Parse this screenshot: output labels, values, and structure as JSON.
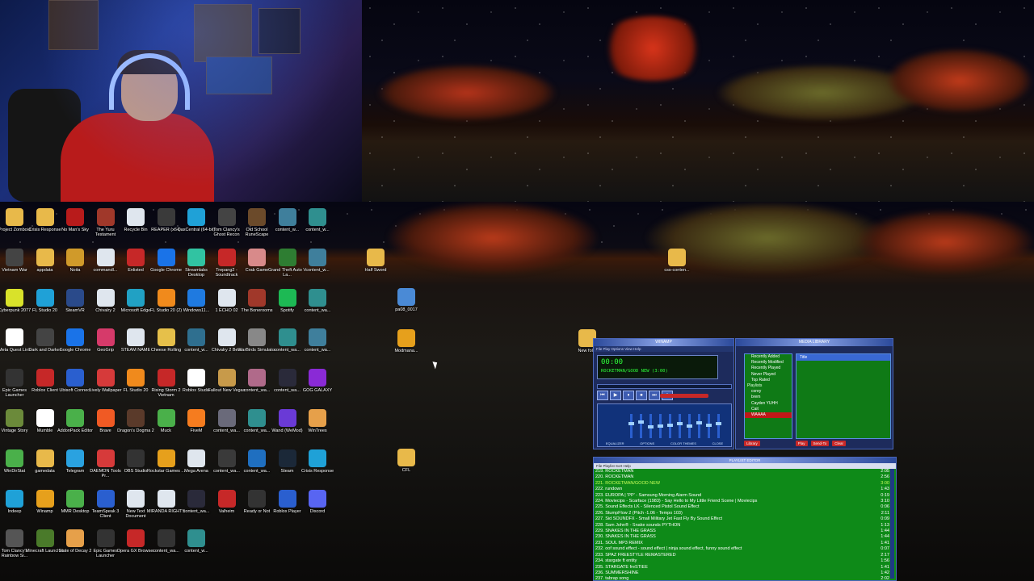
{
  "desktop_icons": [
    {
      "label": "Project Zomboid",
      "icon": "folder-icon",
      "color": "#e8b94a"
    },
    {
      "label": "Crisis Response",
      "icon": "folder-icon",
      "color": "#e8b94a"
    },
    {
      "label": "No Man's Sky",
      "icon": "game-icon",
      "color": "#b81b1b"
    },
    {
      "label": "The Yuru Testament",
      "icon": "game-icon",
      "color": "#a0382a"
    },
    {
      "label": "Recycle Bin",
      "icon": "recycle-bin-icon",
      "color": "#dfe6ee"
    },
    {
      "label": "REAPER (x64)",
      "icon": "reaper-icon",
      "color": "#3a3a3a"
    },
    {
      "label": "DaxCentral (64-bit)",
      "icon": "pc-icon",
      "color": "#1fa1d7"
    },
    {
      "label": "Tom Clancy's Ghost Recon",
      "icon": "game-icon",
      "color": "#444"
    },
    {
      "label": "Old School RuneScape",
      "icon": "game-icon",
      "color": "#6b4a2a"
    },
    {
      "label": "content_w...",
      "icon": "image-icon",
      "color": "#3f7f9c"
    },
    {
      "label": "content_w...",
      "icon": "image-icon",
      "color": "#2f8f8f"
    },
    {
      "label": "Vietnam War",
      "icon": "v-icon",
      "color": "#444"
    },
    {
      "label": "appdata",
      "icon": "folder-icon",
      "color": "#e8b94a"
    },
    {
      "label": "Noita",
      "icon": "game-icon",
      "color": "#d09a2a"
    },
    {
      "label": "commandl...",
      "icon": "doc-icon",
      "color": "#dfe6ee"
    },
    {
      "label": "Enlisted",
      "icon": "game-icon",
      "color": "#c62828"
    },
    {
      "label": "Google Chrome",
      "icon": "g-icon",
      "color": "#1a73e8"
    },
    {
      "label": "Streamlabs Desktop",
      "icon": "streamlabs-icon",
      "color": "#31c3a2"
    },
    {
      "label": "Trepang2 - Soundtrack",
      "icon": "game-icon",
      "color": "#c62828"
    },
    {
      "label": "Crab Game",
      "icon": "game-icon",
      "color": "#d88a8a"
    },
    {
      "label": "Grand Theft Auto V La...",
      "icon": "v-icon",
      "color": "#2e7d32"
    },
    {
      "label": "content_w...",
      "icon": "image-icon",
      "color": "#3f7f9c"
    },
    {
      "label": "Cyberpunk 2077",
      "icon": "game-icon",
      "color": "#d9e22a"
    },
    {
      "label": "FL Studio 20",
      "icon": "flstudio-icon",
      "color": "#1fa1d7"
    },
    {
      "label": "SteamVR",
      "icon": "vr-icon",
      "color": "#2a4a8a"
    },
    {
      "label": "Chivalry 2",
      "icon": "doc-icon",
      "color": "#dfe6ee"
    },
    {
      "label": "Microsoft Edge",
      "icon": "edge-icon",
      "color": "#21a1c4"
    },
    {
      "label": "FL Studio 20 (2)",
      "icon": "flstudio-icon",
      "color": "#f08a1c"
    },
    {
      "label": "Windows11...",
      "icon": "windows-icon",
      "color": "#1f7ae0"
    },
    {
      "label": "1 ECHO 02",
      "icon": "doc-icon",
      "color": "#dfe6ee"
    },
    {
      "label": "The Bonerooms",
      "icon": "game-icon",
      "color": "#a0382a"
    },
    {
      "label": "Spotify",
      "icon": "spotify-icon",
      "color": "#1db954"
    },
    {
      "label": "content_wa...",
      "icon": "image-icon",
      "color": "#2f8f8f"
    },
    {
      "label": "Meta Quest Link",
      "icon": "meta-icon",
      "color": "#ffffff"
    },
    {
      "label": "Dark and Darker",
      "icon": "game-icon",
      "color": "#444"
    },
    {
      "label": "Google Chrome",
      "icon": "chrome-icon",
      "color": "#1a73e8"
    },
    {
      "label": "GeoGrip",
      "icon": "app-icon",
      "color": "#d63a6a"
    },
    {
      "label": "STEAM NAME",
      "icon": "doc-icon",
      "color": "#dfe6ee"
    },
    {
      "label": "Cheese Rolling",
      "icon": "game-icon",
      "color": "#e6c04a"
    },
    {
      "label": "content_w...",
      "icon": "image-icon",
      "color": "#2f6f8f"
    },
    {
      "label": "Chivalry 2 Beta",
      "icon": "doc-icon",
      "color": "#dfe6ee"
    },
    {
      "label": "WarBirds Simulator",
      "icon": "game-icon",
      "color": "#888"
    },
    {
      "label": "content_wa...",
      "icon": "image-icon",
      "color": "#2f8f8f"
    },
    {
      "label": "content_wa...",
      "icon": "image-icon",
      "color": "#3f7f9c"
    },
    {
      "label": "Epic Games Launcher",
      "icon": "epic-icon",
      "color": "#333"
    },
    {
      "label": "Roblox Client",
      "icon": "roblox-icon",
      "color": "#c62828"
    },
    {
      "label": "Ubisoft Connect",
      "icon": "ubisoft-icon",
      "color": "#2a5fcf"
    },
    {
      "label": "Lively Wallpaper",
      "icon": "lively-icon",
      "color": "#d63a3a"
    },
    {
      "label": "FL Studio 20",
      "icon": "flstudio-icon",
      "color": "#f08a1c"
    },
    {
      "label": "Rising Storm 2 Vietnam",
      "icon": "game-icon",
      "color": "#c62828"
    },
    {
      "label": "Roblox Studio",
      "icon": "roblox-icon",
      "color": "#ffffff"
    },
    {
      "label": "Fallout New Vegas",
      "icon": "game-icon",
      "color": "#c79a4a"
    },
    {
      "label": "content_wa...",
      "icon": "image-icon",
      "color": "#b06a8a"
    },
    {
      "label": "content_wa...",
      "icon": "image-icon",
      "color": "#2a2a3a"
    },
    {
      "label": "GOG GALAXY",
      "icon": "gog-icon",
      "color": "#8a2ad6"
    },
    {
      "label": "Vintage Story",
      "icon": "game-icon",
      "color": "#6b8a3a"
    },
    {
      "label": "Mumble",
      "icon": "mumble-icon",
      "color": "#ffffff"
    },
    {
      "label": "AddonPack Editor",
      "icon": "puzzle-icon",
      "color": "#4ab04a"
    },
    {
      "label": "Brave",
      "icon": "brave-icon",
      "color": "#f05a24"
    },
    {
      "label": "Dragon's Dogma 2",
      "icon": "game-icon",
      "color": "#5a3a2a"
    },
    {
      "label": "Muck",
      "icon": "game-icon",
      "color": "#4ab04a"
    },
    {
      "label": "FiveM",
      "icon": "fivem-icon",
      "color": "#f57c1f"
    },
    {
      "label": "content_wa...",
      "icon": "image-icon",
      "color": "#6a6a7a"
    },
    {
      "label": "content_wa...",
      "icon": "image-icon",
      "color": "#2f8f8f"
    },
    {
      "label": "Wand (WeMod)",
      "icon": "wand-icon",
      "color": "#6a3ad6"
    },
    {
      "label": "WinTrees",
      "icon": "game-icon",
      "color": "#e6a04a"
    },
    {
      "label": "WinDirStat",
      "icon": "app-icon",
      "color": "#4ab04a"
    },
    {
      "label": "gamedata",
      "icon": "folder-icon",
      "color": "#e8b94a"
    },
    {
      "label": "Telegram",
      "icon": "telegram-icon",
      "color": "#2aa2e0"
    },
    {
      "label": "DAEMON Tools Pr...",
      "icon": "daemon-icon",
      "color": "#d63a3a"
    },
    {
      "label": "OBS Studio",
      "icon": "obs-icon",
      "color": "#333"
    },
    {
      "label": "Rockstar Games ...",
      "icon": "rockstar-icon",
      "color": "#e6a01c"
    },
    {
      "label": "Mega Arena",
      "icon": "doc-icon",
      "color": "#dfe6ee"
    },
    {
      "label": "content_wa...",
      "icon": "image-icon",
      "color": "#3a3a3a"
    },
    {
      "label": "content_wa...",
      "icon": "image-icon",
      "color": "#1f6fc0"
    },
    {
      "label": "Steam",
      "icon": "steam-icon",
      "color": "#1b2838"
    },
    {
      "label": "Crisis Response",
      "icon": "app-icon",
      "color": "#1fa1d7"
    },
    {
      "label": "Indeep",
      "icon": "app-icon",
      "color": "#1fa1d7"
    },
    {
      "label": "Winamp",
      "icon": "winamp-icon",
      "color": "#e6a01c"
    },
    {
      "label": "MMR Desktop",
      "icon": "app-icon",
      "color": "#4ab04a"
    },
    {
      "label": "TeamSpeak 3 Client",
      "icon": "teamspeak-icon",
      "color": "#2a5fcf"
    },
    {
      "label": "New Text Document",
      "icon": "doc-icon",
      "color": "#dfe6ee"
    },
    {
      "label": "MIRANDA RIGHTS",
      "icon": "doc-icon",
      "color": "#dfe6ee"
    },
    {
      "label": "content_wa...",
      "icon": "image-icon",
      "color": "#2a2a3a"
    },
    {
      "label": "Valheim",
      "icon": "game-icon",
      "color": "#c62828"
    },
    {
      "label": "Ready or Not",
      "icon": "game-icon",
      "color": "#333"
    },
    {
      "label": "Roblox Player",
      "icon": "roblox-icon",
      "color": "#2a5fcf"
    },
    {
      "label": "Discord",
      "icon": "discord-icon",
      "color": "#5865f2"
    },
    {
      "label": "Tom Clancy's Rainbow Si...",
      "icon": "game-icon",
      "color": "#555"
    },
    {
      "label": "Minecraft Launcher",
      "icon": "minecraft-icon",
      "color": "#4a7a2a"
    },
    {
      "label": "State of Decay 2",
      "icon": "game-icon",
      "color": "#e6a04a"
    },
    {
      "label": "Epic Games Launcher",
      "icon": "epic-icon",
      "color": "#333"
    },
    {
      "label": "Opera GX Browser",
      "icon": "opera-icon",
      "color": "#c62828"
    },
    {
      "label": "content_wa...",
      "icon": "image-icon",
      "color": "#333"
    },
    {
      "label": "content_w...",
      "icon": "image-icon",
      "color": "#2f8f8f"
    }
  ],
  "loose_icons": [
    {
      "label": "Half Sword",
      "icon": "folder-icon",
      "color": "#e8b94a"
    },
    {
      "label": "pa08_0017",
      "icon": "app-icon",
      "color": "#4a8ad6"
    },
    {
      "label": "Modmana...",
      "icon": "app-icon",
      "color": "#e6a01c"
    },
    {
      "label": "CFL",
      "icon": "folder-icon",
      "color": "#e8b94a"
    },
    {
      "label": "css-conten...",
      "icon": "folder-icon",
      "color": "#e8b94a"
    },
    {
      "label": "New fol...",
      "icon": "folder-icon",
      "color": "#e8b94a"
    }
  ],
  "winamp": {
    "title": "WINAMP",
    "menu": "File  Play  Options  View  Help",
    "time": "00:00",
    "song": "ROCKETMAN/GOOD NEW (3:00)",
    "controls": [
      "⏮",
      "▶",
      "⏸",
      "⏹",
      "⏭",
      "⏏"
    ],
    "eq_levels": [
      0.6,
      0.7,
      0.45,
      0.5,
      0.55,
      0.6,
      0.5,
      0.65,
      0.55,
      0.6
    ],
    "eq_labels": [
      "EQUALIZER",
      "OPTIONS",
      "COLOR THEMES",
      "CLOSE"
    ]
  },
  "media_library": {
    "title": "MEDIA LIBRARY",
    "tree": [
      {
        "label": "Recently Added",
        "hdr": false,
        "sel": false
      },
      {
        "label": "Recently Modified",
        "hdr": false,
        "sel": false
      },
      {
        "label": "Recently Played",
        "hdr": false,
        "sel": false
      },
      {
        "label": "Never Played",
        "hdr": false,
        "sel": false
      },
      {
        "label": "Top Rated",
        "hdr": false,
        "sel": false
      },
      {
        "label": "Playlists",
        "hdr": true,
        "sel": false
      },
      {
        "label": "corey",
        "hdr": false,
        "sel": false
      },
      {
        "label": "brem",
        "hdr": false,
        "sel": false
      },
      {
        "label": "Cayden YUHH",
        "hdr": false,
        "sel": false
      },
      {
        "label": "Cait",
        "hdr": false,
        "sel": false
      },
      {
        "label": "WAAAA",
        "hdr": false,
        "sel": true
      }
    ],
    "column_title": "Title",
    "library_button": "Library",
    "bottom_buttons": [
      "Play",
      "Send-To",
      "Clear"
    ]
  },
  "playlist": {
    "title": "PLAYLIST EDITOR",
    "menu": "File  Playlist  Sort  Help",
    "rows": [
      {
        "n": "219. ROCKETMAN",
        "d": "2:05",
        "cur": false
      },
      {
        "n": "220. ROCKETMAN",
        "d": "2:56",
        "cur": false
      },
      {
        "n": "221. ROCKETMAN/GOOD NEW",
        "d": "3:00",
        "cur": true
      },
      {
        "n": "222. rundown",
        "d": "1:43",
        "cur": false
      },
      {
        "n": "223. EUROPA | 'PP' - Samsung Morning Alarm Sound",
        "d": "0:19",
        "cur": false
      },
      {
        "n": "224. Moviecips - Scarface (1983) - Say Hello to My Little Friend Scene | Moviecips",
        "d": "3:10",
        "cur": false
      },
      {
        "n": "225. Sound Effects LK - Silenced Pistol Sound Effect",
        "d": "0:06",
        "cur": false
      },
      {
        "n": "226. StumpFlow 2 (Pitch -1.06 - Tempo 103)",
        "d": "2:11",
        "cur": false
      },
      {
        "n": "227. Sid SOUNDFX - Small Military Jet Fast Fly By Sound Effect",
        "d": "0:09",
        "cur": false
      },
      {
        "n": "228. Sam John® - Snake sounds PYTHON",
        "d": "1:13",
        "cur": false
      },
      {
        "n": "229. SNAKES IN THE GRASS",
        "d": "1:44",
        "cur": false
      },
      {
        "n": "230. SNAKES IN THE GRASS",
        "d": "1:44",
        "cur": false
      },
      {
        "n": "231. SOUL MP3 REMIX",
        "d": "1:41",
        "cur": false
      },
      {
        "n": "232. oof sound effect - sound effect | ninja sound effect, funny sound effect",
        "d": "0:07",
        "cur": false
      },
      {
        "n": "233. SPAZ FREESTYLE REMASTERED",
        "d": "2:17",
        "cur": false
      },
      {
        "n": "234. stargate ft entity",
        "d": "1:56",
        "cur": false
      },
      {
        "n": "235. STARGATE freSTIEE",
        "d": "1:41",
        "cur": false
      },
      {
        "n": "236. SUMMERSHINE",
        "d": "1:42",
        "cur": false
      },
      {
        "n": "237. tabrap song",
        "d": "2:02",
        "cur": false
      }
    ]
  }
}
